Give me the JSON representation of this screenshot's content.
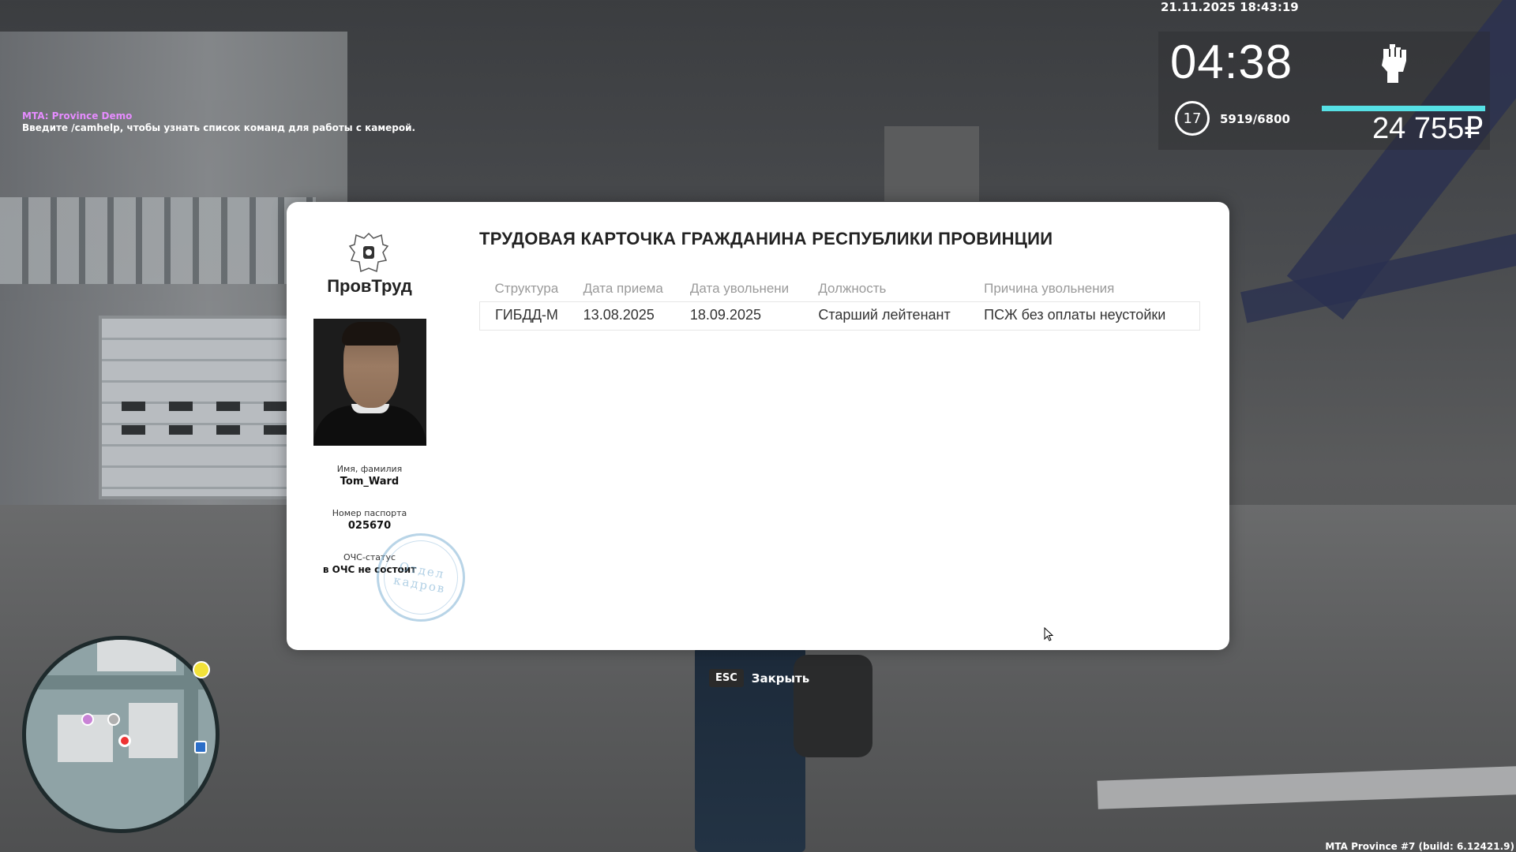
{
  "hud": {
    "chat_title": "MTA: Province Demo",
    "chat_line": "Введите /camhelp, чтобы узнать список команд для работы с камерой.",
    "datetime": "21.11.2025 18:43:19",
    "time": "04:38",
    "level": "17",
    "xp": "5919/6800",
    "money": "24 755₽",
    "health_fraction": 1.0,
    "health_color": "#56e0e5",
    "build": "MTA Province #7 (build: 6.12421.9)"
  },
  "card": {
    "brand": "ПровТруд",
    "title": "ТРУДОВАЯ КАРТОЧКА ГРАЖДАНИНА РЕСПУБЛИКИ ПРОВИНЦИИ",
    "name_label": "Имя, фамилия",
    "name_value": "Tom_Ward",
    "passport_label": "Номер паспорта",
    "passport_value": "025670",
    "ochs_label": "ОЧС-статус",
    "ochs_value": "в ОЧС не состоит",
    "stamp_line1": "Отдел",
    "stamp_line2": "кадров",
    "columns": [
      "Структура",
      "Дата приема",
      "Дата увольнени",
      "Должность",
      "Причина увольнения"
    ],
    "rows": [
      [
        "ГИБДД-М",
        "13.08.2025",
        "18.09.2025",
        "Старший лейтенант",
        "ПСЖ без оплаты неустойки"
      ]
    ]
  },
  "close_hint": {
    "key": "ESC",
    "label": "Закрыть"
  }
}
